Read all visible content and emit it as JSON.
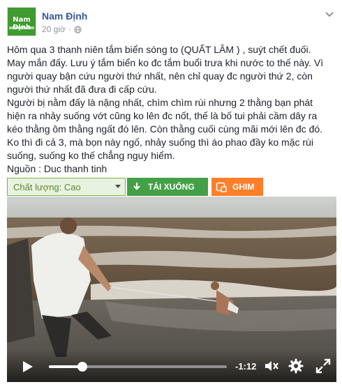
{
  "header": {
    "page_name": "Nam Định",
    "logo_text": "Nam Định",
    "timestamp": "20 giờ",
    "icons": {
      "audience": "globe-icon",
      "menu": "chevron-down-icon"
    }
  },
  "post": {
    "lines": [
      "Hôm qua 3 thanh niên tắm biển sóng to (QUẤT LÂM ) , suýt chết đuối.",
      "May mắn đấy. Lưu ý tắm biển ko đc tắm buổi trưa khi nước to thế này. Vì",
      "người quay bận cứu người thứ nhất, nên chỉ quay đc người thứ 2, còn",
      "người thứ nhất đã đưa đi cấp cứu.",
      "Người bị nằm đấy là nặng nhất, chìm chìm rùi nhưng 2 thằng bạn phát",
      "hiện ra nhảy suống vớt cũng ko lên đc nốt, thế là bố tui phải cầm dây ra",
      "kéo thằng ôm thằng ngất đó lên. Còn thằng cuối cùng mãi mới lên đc đó.",
      "Ko thì đi cả 3, mà bọn này ngố, nhảy suống thì áo phao đầy ko mặc rùi",
      "suống, suống ko thế chẳng nguy hiểm.",
      "Nguồn : Duc thanh tinh"
    ]
  },
  "toolbar": {
    "quality_label": "Chất lượng: Cao",
    "download_label": "TẢI XUỐNG",
    "pin_label": "GHIM",
    "colors": {
      "quality_bg": "#e8f2e1",
      "download": "#43a047",
      "pin": "#ff7f2a"
    }
  },
  "video": {
    "time_remaining": "-1:12",
    "progress": 0.19,
    "icons": {
      "play": "play-icon",
      "mute": "mute-icon",
      "settings": "gear-icon",
      "fullscreen": "fullscreen-icon"
    }
  }
}
